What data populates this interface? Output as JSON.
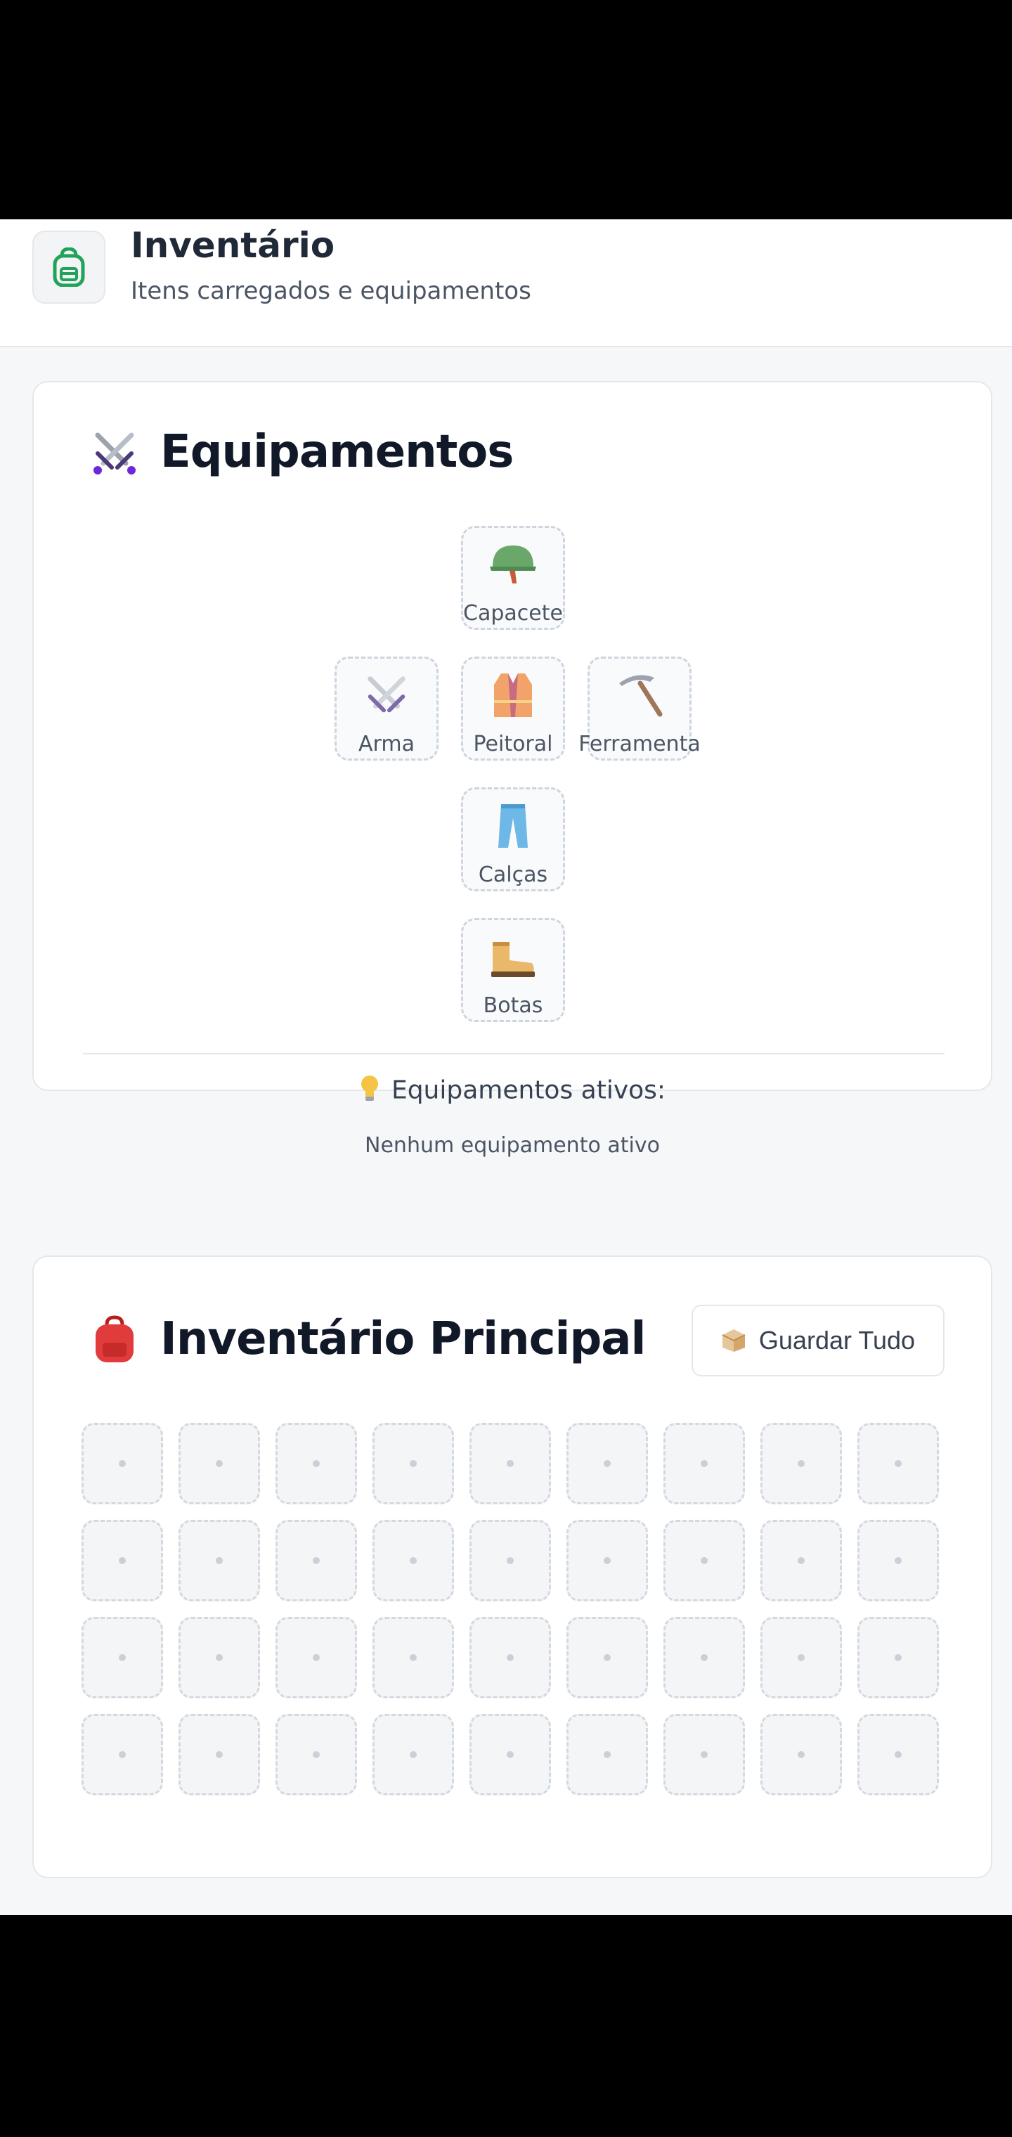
{
  "header": {
    "icon": "backpack-icon",
    "title": "Inventário",
    "subtitle": "Itens carregados e equipamentos"
  },
  "equipment": {
    "title_icon": "crossed-swords-icon",
    "title": "Equipamentos",
    "slots": [
      {
        "id": "helmet",
        "label": "Capacete",
        "icon": "helmet-icon"
      },
      {
        "id": "weapon",
        "label": "Arma",
        "icon": "crossed-swords-icon"
      },
      {
        "id": "chest",
        "label": "Peitoral",
        "icon": "vest-icon"
      },
      {
        "id": "tool",
        "label": "Ferramenta",
        "icon": "pickaxe-icon"
      },
      {
        "id": "pants",
        "label": "Calças",
        "icon": "pants-icon"
      },
      {
        "id": "boots",
        "label": "Botas",
        "icon": "boots-icon"
      }
    ],
    "active_title": "Equipamentos ativos:",
    "active_icon": "lightbulb-icon",
    "active_empty": "Nenhum equipamento ativo"
  },
  "inventory": {
    "title_icon": "red-backpack-icon",
    "title": "Inventário Principal",
    "store_all_label": "Guardar Tudo",
    "store_all_icon": "box-icon",
    "columns": 9,
    "rows": 4,
    "slots_empty": true
  },
  "colors": {
    "page_bg": "#f6f7f9",
    "card_bg": "#ffffff",
    "border": "#e5e7eb",
    "slot_border": "#d4d9e0",
    "header_icon_green": "#22a35a",
    "backpack_red": "#e23b3b"
  }
}
